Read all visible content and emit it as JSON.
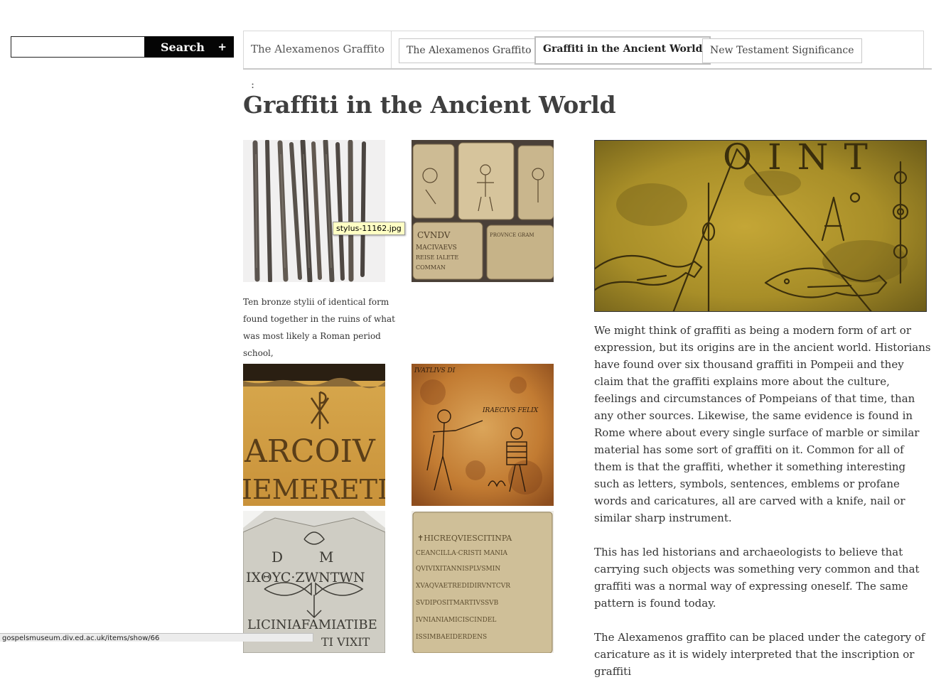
{
  "search": {
    "placeholder": "",
    "value": "",
    "button_label": "Search",
    "advanced_label": "+"
  },
  "nav": {
    "section_label": "The Alexamenos Graffito :",
    "tabs": [
      {
        "label": "The Alexamenos Graffito",
        "active": false
      },
      {
        "label": "Graffiti in the Ancient World",
        "active": true
      },
      {
        "label": "New Testament Significance",
        "active": false
      }
    ]
  },
  "page": {
    "title": "Graffiti in the Ancient World"
  },
  "gallery": {
    "tooltip": "stylus-11162.jpg",
    "caption": "Ten bronze stylii of identical form found together in the ruins of what was most likely a Roman period school,",
    "inscriptions": {
      "tablets_top": "CVNDV",
      "tablets_line2": "MACIVAEVS",
      "tablets_line3": "REISE IALETE",
      "tablets_line4": "COMMAN",
      "tablets_right": "PROVNCE GRAM",
      "chi_rho_line1": "ARCOIV",
      "chi_rho_line2": "IEMERETI",
      "fresco_label1": "IVATLIVS DI",
      "fresco_label2": "IRAECIVS FELIX",
      "fish_dm": "D        M",
      "fish_line": "IXΘYC·ZWNTWN",
      "fish_line3": "LICINIAFAMIATIBE",
      "fish_line4": "TI VIXIT",
      "slab_line1": "✝HICREQVIESCITINPA",
      "slab_line2": "CEANCILLA·CRISTI MANIA",
      "slab_line3": "QVIVIXITANNISPLVSMIN",
      "slab_line4": "XVAQVAETREDIDIRVNTCVR",
      "slab_line5": "SVDIPOSITMARTIVSSVB",
      "slab_line6": "IVNIANIAMICISCINDEL",
      "slab_line7": "ISSIMBAEIDERDENS"
    }
  },
  "feature": {
    "inscription": "OINT"
  },
  "article": {
    "paragraphs": [
      "We might think of graffiti as being a modern form of art or expression, but its origins are in the ancient world. Historians have found over six thousand graffiti in Pompeii and they claim that the graffiti explains more about the culture, feelings and circumstances of Pompeians of that time, than any other sources. Likewise, the same evidence is found in Rome where about every single surface of marble or similar material has some sort of graffiti on it. Common for all of them is that the graffiti, whether it something interesting such as letters, symbols, sentences, emblems or profane words and caricatures, all are carved with a knife, nail or similar sharp instrument.",
      "This has led historians and archaeologists to believe that carrying such objects was something very common and that graffiti was a normal way of expressing oneself. The same pattern is found today.",
      "The Alexamenos graffito can be placed under the category of caricature as it is  widely interpreted that the inscription or graffiti"
    ]
  },
  "status": {
    "url": "gospelsmuseum.div.ed.ac.uk/items/show/66"
  },
  "colors": {
    "accent": "#050505",
    "tab_border": "#c8c8c8",
    "tooltip_bg": "#ffffc4",
    "bronze": "#5a534d",
    "sandstone": "#c4b080",
    "ochre": "#b87a30",
    "feature_gold": "#a88e28"
  }
}
